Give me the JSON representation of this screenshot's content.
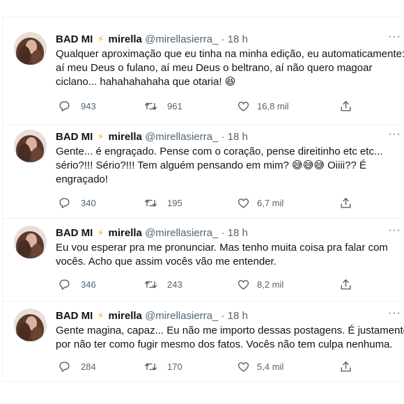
{
  "tweets": [
    {
      "display_name": "BAD MI",
      "emoji": "⚡",
      "name2": "mirella",
      "handle": "@mirellasierra_",
      "separator": "·",
      "time": "18 h",
      "lines": [
        "Qualquer aproximação que eu tinha na minha edição, eu automaticamente:",
        "aí meu Deus o fulano, aí meu Deus o beltrano, aí não quero magoar",
        "ciclano... hahahahahaha que otaria! 😆"
      ],
      "replies": "943",
      "retweets": "961",
      "likes": "16,8 mil"
    },
    {
      "display_name": "BAD MI",
      "emoji": "⚡",
      "name2": "mirella",
      "handle": "@mirellasierra_",
      "separator": "·",
      "time": "18 h",
      "lines": [
        "Gente... é engraçado. Pense com o coração, pense direitinho etc etc...",
        "sério?!!! Sério?!!! Tem alguém pensando em mim? 😅😅😅 Oiiii?? É",
        "engraçado!"
      ],
      "replies": "340",
      "retweets": "195",
      "likes": "6,7 mil"
    },
    {
      "display_name": "BAD MI",
      "emoji": "⚡",
      "name2": "mirella",
      "handle": "@mirellasierra_",
      "separator": "·",
      "time": "18 h",
      "lines": [
        "Eu vou esperar pra me pronunciar. Mas tenho muita coisa pra falar com",
        "vocês. Acho que assim vocês vão me entender."
      ],
      "replies": "346",
      "retweets": "243",
      "likes": "8,2 mil"
    },
    {
      "display_name": "BAD MI",
      "emoji": "⚡",
      "name2": "mirella",
      "handle": "@mirellasierra_",
      "separator": "·",
      "time": "18 h",
      "lines": [
        "Gente magina, capaz... Eu não me importo dessas postagens. É justamente",
        "por não ter como fugir mesmo dos fatos. Vocês não tem culpa nenhuma."
      ],
      "replies": "284",
      "retweets": "170",
      "likes": "5,4 mil"
    }
  ],
  "colors": {
    "text": "#0f1419",
    "secondary": "#536471",
    "border": "#eff3f4",
    "bolt": "#f4b400"
  },
  "icons": [
    "reply-icon",
    "retweet-icon",
    "like-icon",
    "share-icon",
    "more-icon"
  ]
}
